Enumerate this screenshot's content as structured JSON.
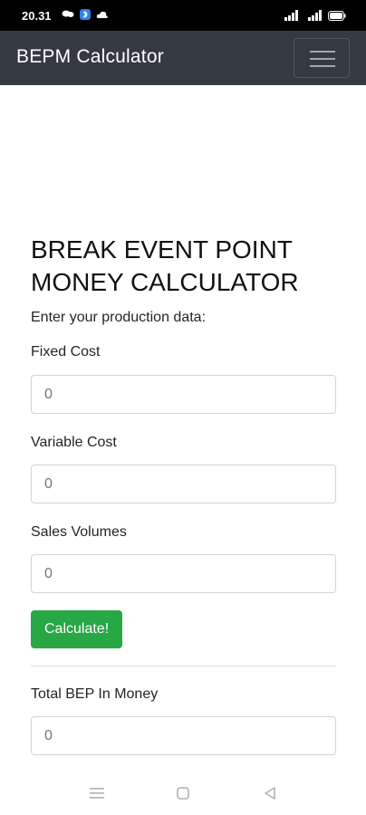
{
  "status_bar": {
    "time": "20.31",
    "icons": [
      "chat-bubbles-icon",
      "bluetooth-icon",
      "cloud-icon",
      "cell-signal-icon",
      "wifi-signal-icon",
      "battery-icon"
    ]
  },
  "navbar": {
    "brand": "BEPM Calculator",
    "toggler_icon": "hamburger-menu-icon",
    "background": "#343a40"
  },
  "main": {
    "title": "BREAK EVENT POINT MONEY CALCULATOR",
    "intro": "Enter your production data:",
    "fields": [
      {
        "label": "Fixed Cost",
        "placeholder": "0"
      },
      {
        "label": "Variable Cost",
        "placeholder": "0"
      },
      {
        "label": "Sales Volumes",
        "placeholder": "0"
      }
    ],
    "calculate_label": "Calculate!",
    "result": {
      "label": "Total BEP In Money",
      "placeholder": "0"
    }
  },
  "colors": {
    "accent_green": "#28a745",
    "navbar_dark": "#343a40"
  },
  "bottom_nav": {
    "icons": [
      "recent-apps-icon",
      "home-icon",
      "back-icon"
    ]
  }
}
